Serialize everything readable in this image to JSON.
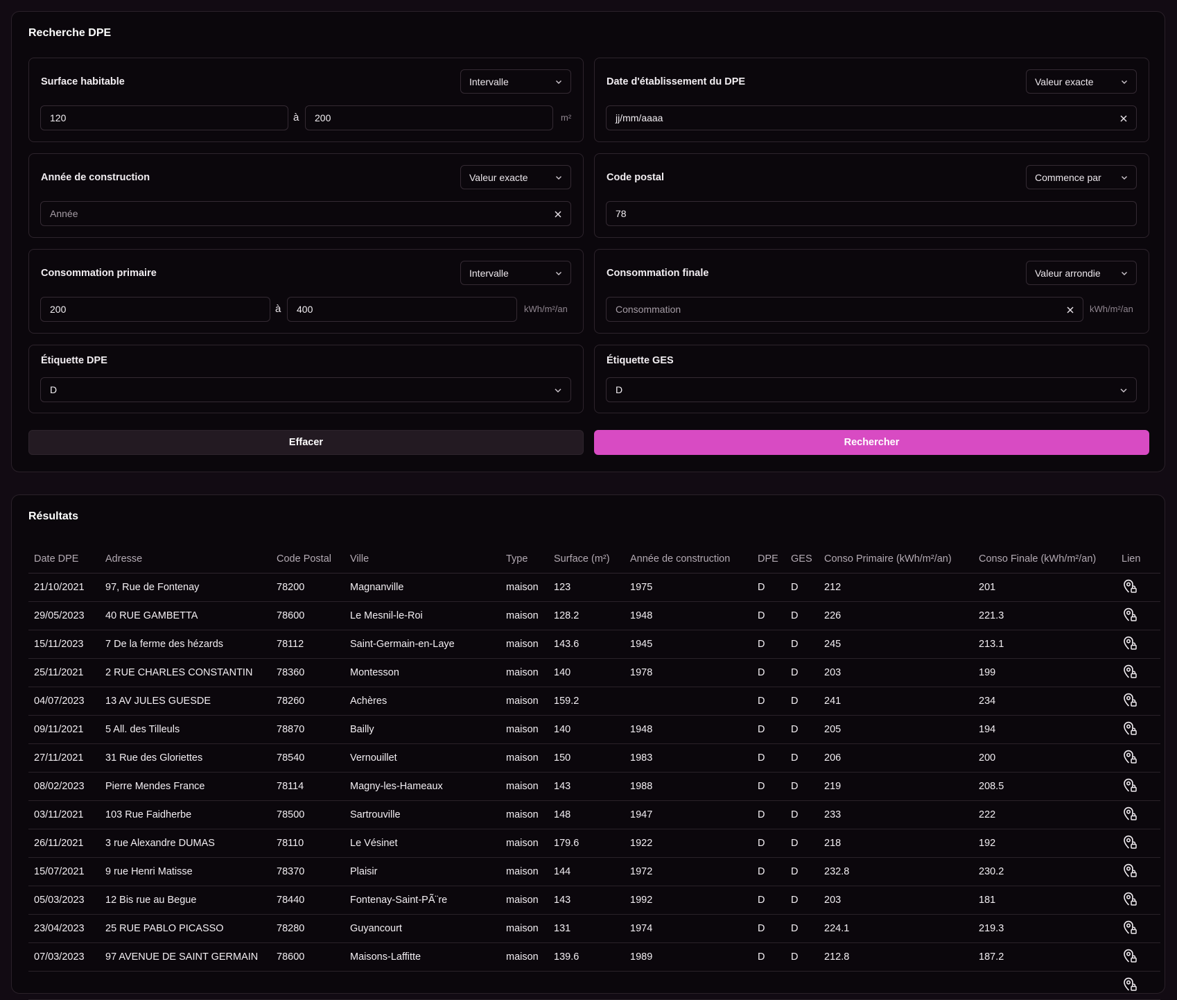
{
  "search": {
    "title": "Recherche DPE",
    "surface": {
      "label": "Surface habitable",
      "mode": "Intervalle",
      "from": "120",
      "to_word": "à",
      "to": "200",
      "unit": "m²"
    },
    "date": {
      "label": "Date d'établissement du DPE",
      "mode": "Valeur exacte",
      "value": "jj/mm/aaaa"
    },
    "annee": {
      "label": "Année de construction",
      "mode": "Valeur exacte",
      "placeholder": "Année"
    },
    "code_postal": {
      "label": "Code postal",
      "mode": "Commence par",
      "value": "78"
    },
    "conso_primaire": {
      "label": "Consommation primaire",
      "mode": "Intervalle",
      "from": "200",
      "to_word": "à",
      "to": "400",
      "unit": "kWh/m²/an"
    },
    "conso_finale": {
      "label": "Consommation finale",
      "mode": "Valeur arrondie",
      "placeholder": "Consommation",
      "unit": "kWh/m²/an"
    },
    "etiquette_dpe": {
      "label": "Étiquette DPE",
      "value": "D"
    },
    "etiquette_ges": {
      "label": "Étiquette GES",
      "value": "D"
    },
    "clear_label": "Effacer",
    "search_label": "Rechercher",
    "accent_color": "#d84bc3"
  },
  "results": {
    "title": "Résultats",
    "columns": [
      "Date DPE",
      "Adresse",
      "Code Postal",
      "Ville",
      "Type",
      "Surface (m²)",
      "Année de construction",
      "DPE",
      "GES",
      "Conso Primaire (kWh/m²/an)",
      "Conso Finale (kWh/m²/an)",
      "Lien"
    ],
    "link_icon": "location-pin-lock-icon",
    "rows": [
      [
        "21/10/2021",
        "97, Rue de Fontenay",
        "78200",
        "Magnanville",
        "maison",
        "123",
        "1975",
        "D",
        "D",
        "212",
        "201"
      ],
      [
        "29/05/2023",
        "40 RUE GAMBETTA",
        "78600",
        "Le Mesnil-le-Roi",
        "maison",
        "128.2",
        "1948",
        "D",
        "D",
        "226",
        "221.3"
      ],
      [
        "15/11/2023",
        "7 De la ferme des hézards",
        "78112",
        "Saint-Germain-en-Laye",
        "maison",
        "143.6",
        "1945",
        "D",
        "D",
        "245",
        "213.1"
      ],
      [
        "25/11/2021",
        "2 RUE CHARLES CONSTANTIN",
        "78360",
        "Montesson",
        "maison",
        "140",
        "1978",
        "D",
        "D",
        "203",
        "199"
      ],
      [
        "04/07/2023",
        "13 AV JULES GUESDE",
        "78260",
        "Achères",
        "maison",
        "159.2",
        "",
        "D",
        "D",
        "241",
        "234"
      ],
      [
        "09/11/2021",
        "5 All. des Tilleuls",
        "78870",
        "Bailly",
        "maison",
        "140",
        "1948",
        "D",
        "D",
        "205",
        "194"
      ],
      [
        "27/11/2021",
        "31 Rue des Gloriettes",
        "78540",
        "Vernouillet",
        "maison",
        "150",
        "1983",
        "D",
        "D",
        "206",
        "200"
      ],
      [
        "08/02/2023",
        "Pierre Mendes France",
        "78114",
        "Magny-les-Hameaux",
        "maison",
        "143",
        "1988",
        "D",
        "D",
        "219",
        "208.5"
      ],
      [
        "03/11/2021",
        "103 Rue Faidherbe",
        "78500",
        "Sartrouville",
        "maison",
        "148",
        "1947",
        "D",
        "D",
        "233",
        "222"
      ],
      [
        "26/11/2021",
        "3 rue Alexandre DUMAS",
        "78110",
        "Le Vésinet",
        "maison",
        "179.6",
        "1922",
        "D",
        "D",
        "218",
        "192"
      ],
      [
        "15/07/2021",
        "9 rue Henri Matisse",
        "78370",
        "Plaisir",
        "maison",
        "144",
        "1972",
        "D",
        "D",
        "232.8",
        "230.2"
      ],
      [
        "05/03/2023",
        "12 Bis rue au Begue",
        "78440",
        "Fontenay-Saint-PÃ¨re",
        "maison",
        "143",
        "1992",
        "D",
        "D",
        "203",
        "181"
      ],
      [
        "23/04/2023",
        "25 RUE PABLO PICASSO",
        "78280",
        "Guyancourt",
        "maison",
        "131",
        "1974",
        "D",
        "D",
        "224.1",
        "219.3"
      ],
      [
        "07/03/2023",
        "97 AVENUE DE SAINT GERMAIN",
        "78600",
        "Maisons-Laffitte",
        "maison",
        "139.6",
        "1989",
        "D",
        "D",
        "212.8",
        "187.2"
      ],
      [
        "",
        "",
        "",
        "",
        "",
        "",
        "",
        "",
        "",
        "",
        ""
      ]
    ]
  }
}
